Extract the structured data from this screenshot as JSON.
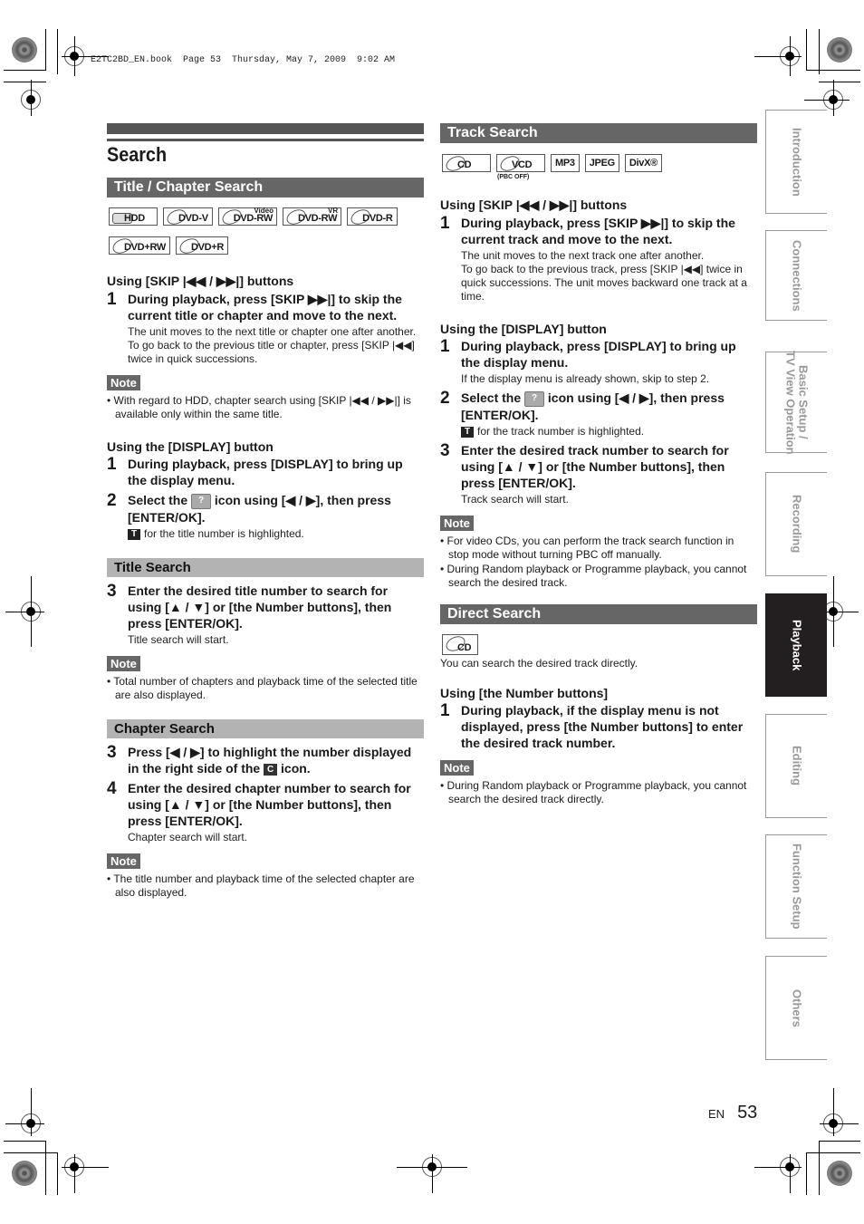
{
  "print_header": "E2TC2BD_EN.book  Page 53  Thursday, May 7, 2009  9:02 AM",
  "page_title": "Search",
  "left": {
    "section_title": "Title / Chapter Search",
    "badges": [
      {
        "label": "HDD",
        "icon": "hdd-icon"
      },
      {
        "label": "DVD-V",
        "icon": "disc-icon"
      },
      {
        "label": "DVD-RW",
        "sup": "Video",
        "icon": "disc-icon"
      },
      {
        "label": "DVD-RW",
        "sup": "VR",
        "icon": "disc-icon"
      },
      {
        "label": "DVD-R",
        "icon": "disc-icon"
      },
      {
        "label": "DVD+RW",
        "icon": "disc-icon"
      },
      {
        "label": "DVD+R",
        "icon": "disc-icon"
      }
    ],
    "skip_label": "Using [SKIP |◀◀ / ▶▶|] buttons",
    "skip_step1_num": "1",
    "skip_step1": "During playback, press [SKIP ▶▶|] to skip the current title or chapter and move to the next.",
    "skip_body1": "The unit moves to the next title or chapter one after another.",
    "skip_body2": "To go back to the previous title or chapter, press [SKIP |◀◀] twice in quick successions.",
    "note_label": "Note",
    "skip_note": "With regard to HDD, chapter search using [SKIP |◀◀ / ▶▶|] is available only within the same title.",
    "display_label": "Using the [DISPLAY] button",
    "disp_step1_num": "1",
    "disp_step1": "During playback, press [DISPLAY] to bring up the display menu.",
    "disp_step2_num": "2",
    "disp_step2_a": "Select the",
    "disp_step2_b": "icon using [◀ / ▶], then press [ENTER/OK].",
    "disp_step2_body": "for the title number is highlighted.",
    "t_icon": "T",
    "title_search": {
      "heading": "Title Search",
      "step_num": "3",
      "step": "Enter the desired title number to search for using [▲ / ▼] or [the Number buttons], then press [ENTER/OK].",
      "body": "Title search will start.",
      "note": "Total number of chapters and playback time of the selected title are also displayed."
    },
    "chapter_search": {
      "heading": "Chapter Search",
      "step3_num": "3",
      "step3_a": "Press [◀ / ▶] to highlight the number displayed in the right side of the",
      "step3_b": "icon.",
      "c_icon": "C",
      "step4_num": "4",
      "step4": "Enter the desired chapter number to search for using [▲ / ▼] or [the Number buttons], then press [ENTER/OK].",
      "body": "Chapter search will start.",
      "note": "The title number and playback time of the selected chapter are also displayed."
    }
  },
  "right": {
    "track_search": {
      "heading": "Track Search",
      "badges": [
        {
          "label": "CD",
          "icon": "disc-icon"
        },
        {
          "label": "VCD",
          "icon": "disc-icon",
          "note": "(PBC OFF)"
        },
        {
          "label": "MP3"
        },
        {
          "label": "JPEG"
        },
        {
          "label": "DivX®"
        }
      ],
      "skip_label": "Using [SKIP |◀◀ / ▶▶|] buttons",
      "skip_step1_num": "1",
      "skip_step1": "During playback, press [SKIP ▶▶|] to skip the current track and move to the next.",
      "skip_body1": "The unit moves to the next track one after another.",
      "skip_body2": "To go back to the previous track, press [SKIP |◀◀] twice in quick successions. The unit moves backward one track at a time.",
      "display_label": "Using the [DISPLAY] button",
      "disp_step1_num": "1",
      "disp_step1": "During playback, press [DISPLAY] to bring up the display menu.",
      "disp_step1_body": "If the display menu is already shown, skip to step 2.",
      "disp_step2_num": "2",
      "disp_step2_a": "Select the",
      "disp_step2_b": "icon using [◀ / ▶], then press [ENTER/OK].",
      "disp_step2_body": "for the track number is highlighted.",
      "disp_step3_num": "3",
      "disp_step3": "Enter the desired track number to search for using [▲ / ▼] or [the Number buttons], then press [ENTER/OK].",
      "disp_step3_body": "Track search will start.",
      "note_label": "Note",
      "notes": [
        "For video CDs, you can perform the track search function in stop mode without turning PBC off manually.",
        "During Random playback or Programme playback, you cannot search the desired track."
      ]
    },
    "direct_search": {
      "heading": "Direct Search",
      "badge": "CD",
      "intro": "You can search the desired track directly.",
      "label": "Using [the Number buttons]",
      "step_num": "1",
      "step": "During playback, if the display menu is not displayed, press [the Number buttons] to enter the desired track number.",
      "note_label": "Note",
      "note": "During Random playback or Programme playback, you cannot search the desired track directly."
    }
  },
  "side_tabs": [
    {
      "label": "Introduction",
      "active": false
    },
    {
      "label": "Connections",
      "active": false
    },
    {
      "label": "Basic Setup /\nTV View Operation",
      "active": false
    },
    {
      "label": "Recording",
      "active": false
    },
    {
      "label": "Playback",
      "active": true
    },
    {
      "label": "Editing",
      "active": false
    },
    {
      "label": "Function Setup",
      "active": false
    },
    {
      "label": "Others",
      "active": false
    }
  ],
  "footer": {
    "lang": "EN",
    "page": "53"
  }
}
